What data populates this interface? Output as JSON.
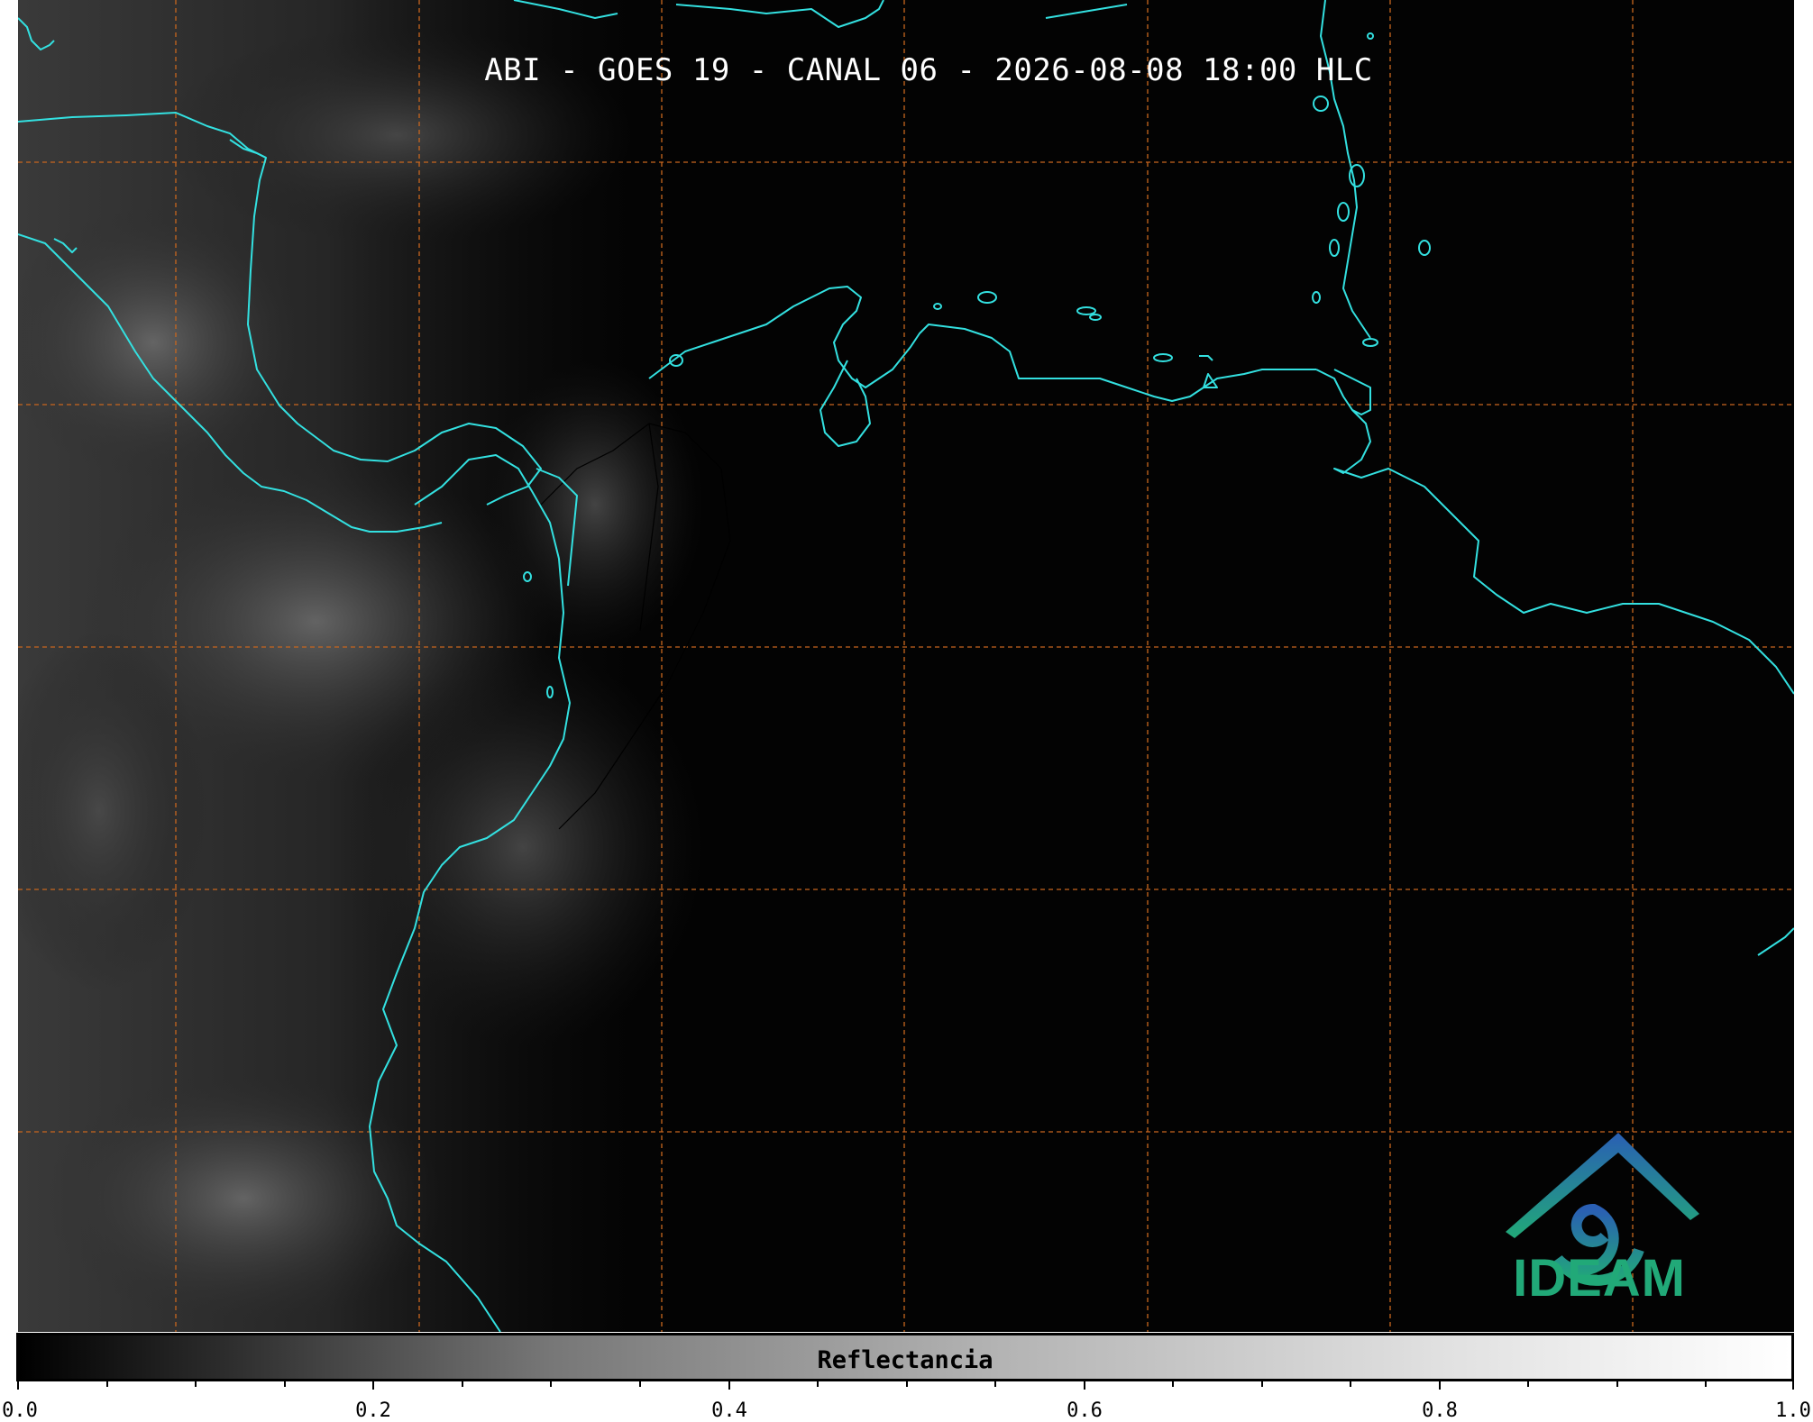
{
  "map": {
    "title": "ABI - GOES 19 - CANAL 06 - 2026-08-08 18:00 HLC",
    "coastline_color": "#33e0e0",
    "grid_color": "#c8661e",
    "logo": {
      "text": "IDEAM",
      "icon": "ideam-mountain-spiral-logo"
    }
  },
  "colorbar": {
    "label": "Reflectancia",
    "ticks": [
      "0.0",
      "0.2",
      "0.4",
      "0.6",
      "0.8",
      "1.0"
    ],
    "range": [
      0.0,
      1.0
    ]
  }
}
